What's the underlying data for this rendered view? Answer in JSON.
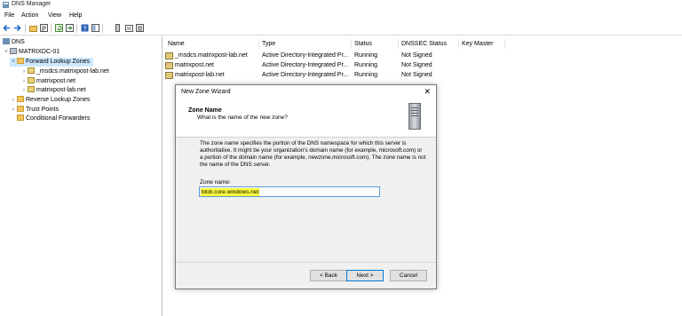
{
  "window": {
    "title": "DNS Manager"
  },
  "menu": [
    "File",
    "Action",
    "View",
    "Help"
  ],
  "toolbar": {
    "icons": [
      "back-icon",
      "forward-icon",
      "folder-up-icon",
      "properties-icon",
      "refresh-icon",
      "export-icon",
      "help-icon",
      "show-hide-icon",
      "server-icon",
      "zone-icon",
      "list-icon"
    ]
  },
  "tree": {
    "root": "DNS",
    "server": "MATRIXDC-01",
    "forward": "Forward Lookup Zones",
    "zones": [
      "_msdcs.matrixpost-lab.net",
      "matrixpost.net",
      "matrixpost-lab.net"
    ],
    "reverse": "Reverse Lookup Zones",
    "trust": "Trust Points",
    "conditional": "Conditional Forwarders"
  },
  "list": {
    "columns": [
      "Name",
      "Type",
      "Status",
      "DNSSEC Status",
      "Key Master"
    ],
    "rows": [
      [
        "_msdcs.matrixpost-lab.net",
        "Active Directory-Integrated Pr...",
        "Running",
        "Not Signed",
        ""
      ],
      [
        "matrixpost.net",
        "Active Directory-Integrated Pr...",
        "Running",
        "Not Signed",
        ""
      ],
      [
        "matrixpost-lab.net",
        "Active Directory-Integrated Pr...",
        "Running",
        "Not Signed",
        ""
      ]
    ]
  },
  "wizard": {
    "title": "New Zone Wizard",
    "close": "✕",
    "heading": "Zone Name",
    "subheading": "What is the name of the new zone?",
    "description": "The zone name specifies the portion of the DNS namespace for which this server is authoritative. It might be your organization's domain name (for example,  microsoft.com) or a portion of the domain name (for example, newzone.microsoft.com). The zone name is not the name of the DNS server.",
    "zone_label": "Zone name:",
    "zone_value": "blob.core.windows.net",
    "back": "< Back",
    "next": "Next >",
    "cancel": "Cancel"
  }
}
